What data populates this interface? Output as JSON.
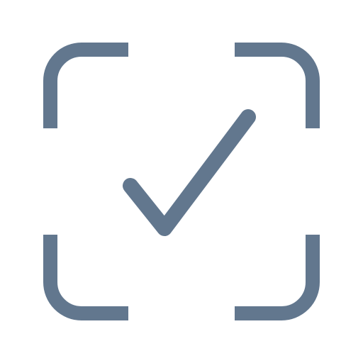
{
  "icon": {
    "name": "scan-check-icon",
    "color": "#62778e",
    "background": "#ffffff",
    "parts": {
      "frame": "scan-frame-corners",
      "mark": "checkmark"
    }
  }
}
